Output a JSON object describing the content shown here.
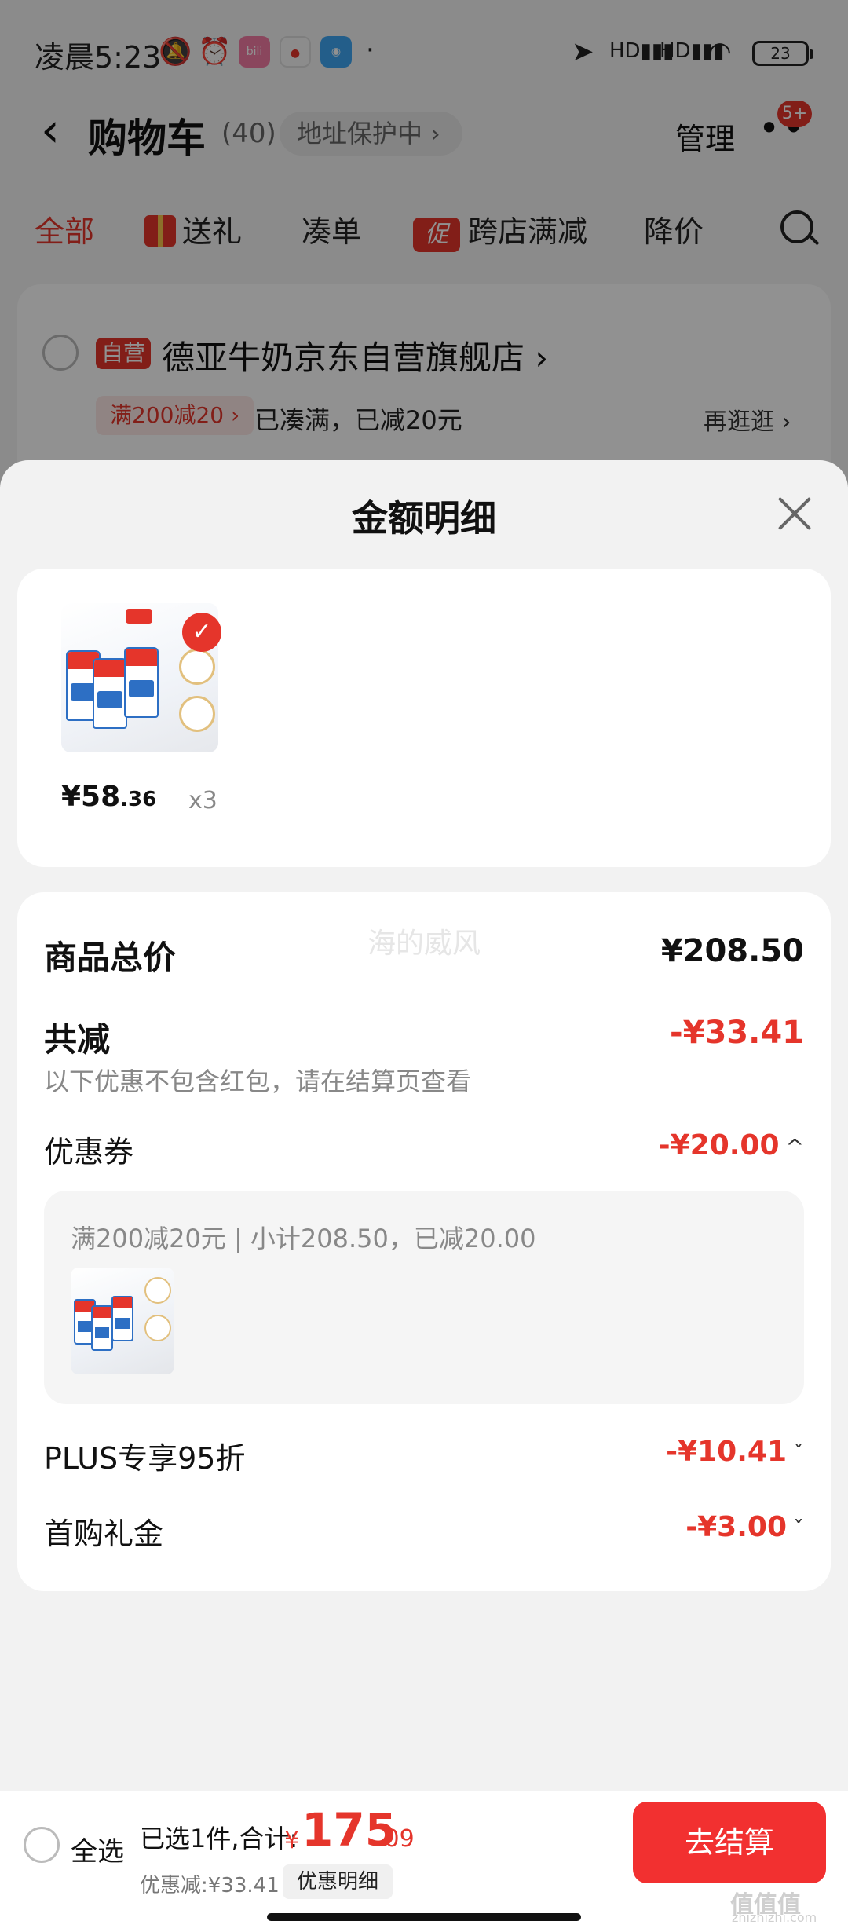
{
  "status_bar": {
    "time": "凌晨5:23",
    "icons": [
      "mute-icon",
      "alarm-icon",
      "bilibili-app-icon",
      "map-app-icon",
      "browser-app-icon",
      "location-icon",
      "signal-hd-icon",
      "signal-hd-icon",
      "wifi-icon"
    ],
    "battery": "23"
  },
  "navbar": {
    "back": "‹",
    "title": "购物车",
    "count": "(40)",
    "address_protect": "地址保护中 ›",
    "manage": "管理",
    "more_badge": "5+"
  },
  "tabs": [
    {
      "label": "全部",
      "active": true
    },
    {
      "label": "送礼",
      "active": false
    },
    {
      "label": "凑单",
      "active": false
    },
    {
      "label": "跨店满减",
      "tag": "促",
      "active": false
    },
    {
      "label": "降价",
      "active": false
    }
  ],
  "store": {
    "self_tag": "自营",
    "name": "德亚牛奶京东自营旗舰店 ›",
    "promo_chip": "满200减20 ›",
    "promo_note": "已凑满，已减20元",
    "browse_more": "再逛逛 ›"
  },
  "sheet": {
    "title": "金额明细",
    "product": {
      "price_int": "¥58",
      "price_dec": ".36",
      "qty": "x3"
    },
    "watermark": "海的威风",
    "goods_total_label": "商品总价",
    "goods_total_value": "¥208.50",
    "discount_label": "共减",
    "discount_value": "-¥33.41",
    "discount_note": "以下优惠不包含红包，请在结算页查看",
    "coupon_label": "优惠券",
    "coupon_value": "-¥20.00",
    "coupon_detail": "满200减20元 | 小计208.50，已减20.00",
    "plus_label": "PLUS专享95折",
    "plus_value": "-¥10.41",
    "first_label": "首购礼金",
    "first_value": "-¥3.00"
  },
  "bottom": {
    "select_all": "全选",
    "sum_label": "已选1件,合计:",
    "sum_yen": "¥",
    "sum_int": "175",
    "sum_dec": ".09",
    "saved": "优惠减:¥33.41",
    "detail_pill": "优惠明细",
    "checkout": "去结算",
    "site_watermark": "值值值",
    "site_url": "zhizhizhi.com"
  },
  "colors": {
    "accent": "#e5352b",
    "checkout_button": "#f23030"
  }
}
